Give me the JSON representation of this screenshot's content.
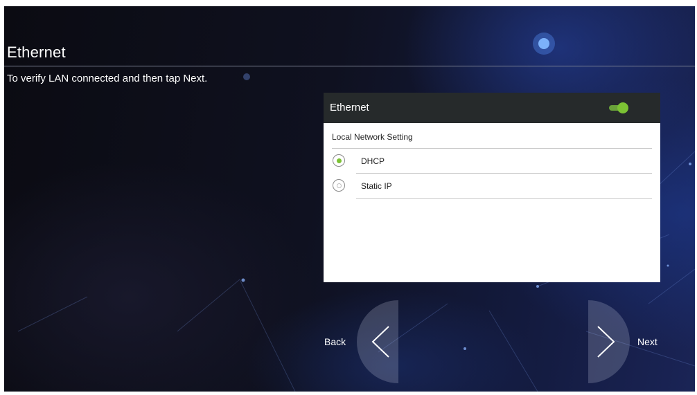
{
  "page": {
    "title": "Ethernet",
    "instruction": "To verify LAN connected and then tap Next."
  },
  "panel": {
    "header_title": "Ethernet",
    "toggle_on": true,
    "section_label": "Local Network Setting",
    "options": [
      {
        "label": "DHCP",
        "selected": true
      },
      {
        "label": "Static IP",
        "selected": false
      }
    ]
  },
  "nav": {
    "back_label": "Back",
    "next_label": "Next"
  },
  "colors": {
    "accent_green": "#7cc234",
    "panel_header": "#262a2b"
  },
  "icons": {
    "back": "chevron-left-icon",
    "next": "chevron-right-icon"
  }
}
